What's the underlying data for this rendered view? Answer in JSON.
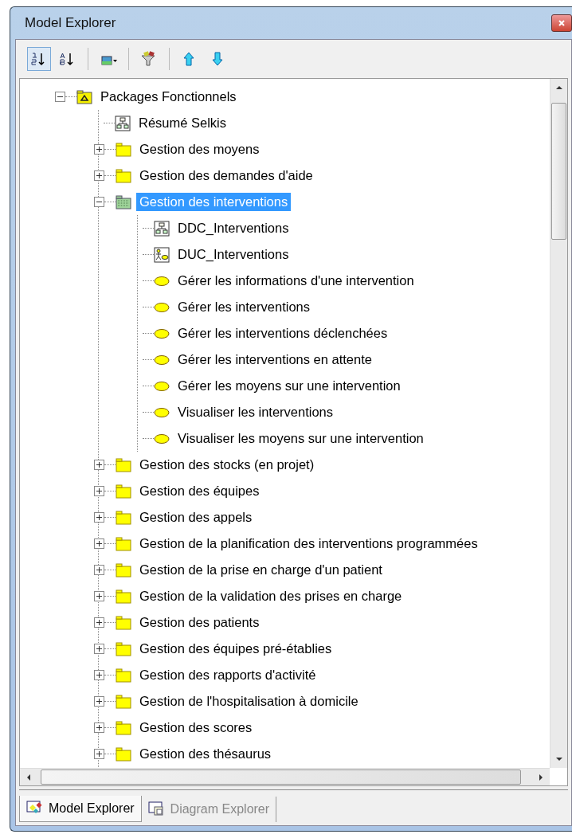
{
  "window": {
    "title": "Model Explorer"
  },
  "toolbar": [
    {
      "kind": "sort-order",
      "pressed": true
    },
    {
      "kind": "sort-alpha",
      "pressed": false
    },
    {
      "kind": "view-menu",
      "pressed": false
    },
    {
      "kind": "filter",
      "pressed": false
    },
    {
      "kind": "move-up",
      "pressed": false
    },
    {
      "kind": "move-down",
      "pressed": false
    }
  ],
  "tree": [
    {
      "label": "Packages Fonctionnels",
      "kind": "package",
      "expanded": true,
      "selected": false,
      "children": [
        {
          "label": "Résumé Selkis",
          "kind": "diagram",
          "selected": false
        },
        {
          "label": "Gestion des moyens",
          "kind": "folder",
          "expanded": false,
          "selected": false
        },
        {
          "label": "Gestion des demandes d'aide",
          "kind": "folder",
          "expanded": false,
          "selected": false
        },
        {
          "label": "Gestion des interventions",
          "kind": "folder-shaded",
          "expanded": true,
          "selected": true,
          "children": [
            {
              "label": "DDC_Interventions",
              "kind": "diagram",
              "selected": false
            },
            {
              "label": "DUC_Interventions",
              "kind": "usecase-diagram",
              "selected": false
            },
            {
              "label": "Gérer les informations d'une intervention",
              "kind": "usecase",
              "selected": false
            },
            {
              "label": "Gérer les interventions",
              "kind": "usecase",
              "selected": false
            },
            {
              "label": "Gérer les interventions déclenchées",
              "kind": "usecase",
              "selected": false
            },
            {
              "label": "Gérer les interventions en attente",
              "kind": "usecase",
              "selected": false
            },
            {
              "label": "Gérer les moyens sur une intervention",
              "kind": "usecase",
              "selected": false
            },
            {
              "label": "Visualiser les interventions",
              "kind": "usecase",
              "selected": false
            },
            {
              "label": "Visualiser les moyens sur une intervention",
              "kind": "usecase",
              "selected": false
            }
          ]
        },
        {
          "label": "Gestion des stocks (en projet)",
          "kind": "folder",
          "expanded": false,
          "selected": false
        },
        {
          "label": "Gestion des équipes",
          "kind": "folder",
          "expanded": false,
          "selected": false
        },
        {
          "label": "Gestion des appels",
          "kind": "folder",
          "expanded": false,
          "selected": false
        },
        {
          "label": "Gestion de la planification des interventions programmées",
          "kind": "folder",
          "expanded": false,
          "selected": false
        },
        {
          "label": "Gestion de la prise en charge d'un patient",
          "kind": "folder",
          "expanded": false,
          "selected": false
        },
        {
          "label": "Gestion de la validation des prises en charge",
          "kind": "folder",
          "expanded": false,
          "selected": false
        },
        {
          "label": "Gestion des patients",
          "kind": "folder",
          "expanded": false,
          "selected": false
        },
        {
          "label": "Gestion des équipes pré-établies",
          "kind": "folder",
          "expanded": false,
          "selected": false
        },
        {
          "label": "Gestion des rapports d'activité",
          "kind": "folder",
          "expanded": false,
          "selected": false
        },
        {
          "label": "Gestion de l'hospitalisation à domicile",
          "kind": "folder",
          "expanded": false,
          "selected": false
        },
        {
          "label": "Gestion des scores",
          "kind": "folder",
          "expanded": false,
          "selected": false
        },
        {
          "label": "Gestion des thésaurus",
          "kind": "folder",
          "expanded": false,
          "selected": false
        }
      ]
    }
  ],
  "tabs": [
    {
      "label": "Model Explorer",
      "kind": "model",
      "selected": true
    },
    {
      "label": "Diagram Explorer",
      "kind": "diagram",
      "selected": false
    }
  ]
}
